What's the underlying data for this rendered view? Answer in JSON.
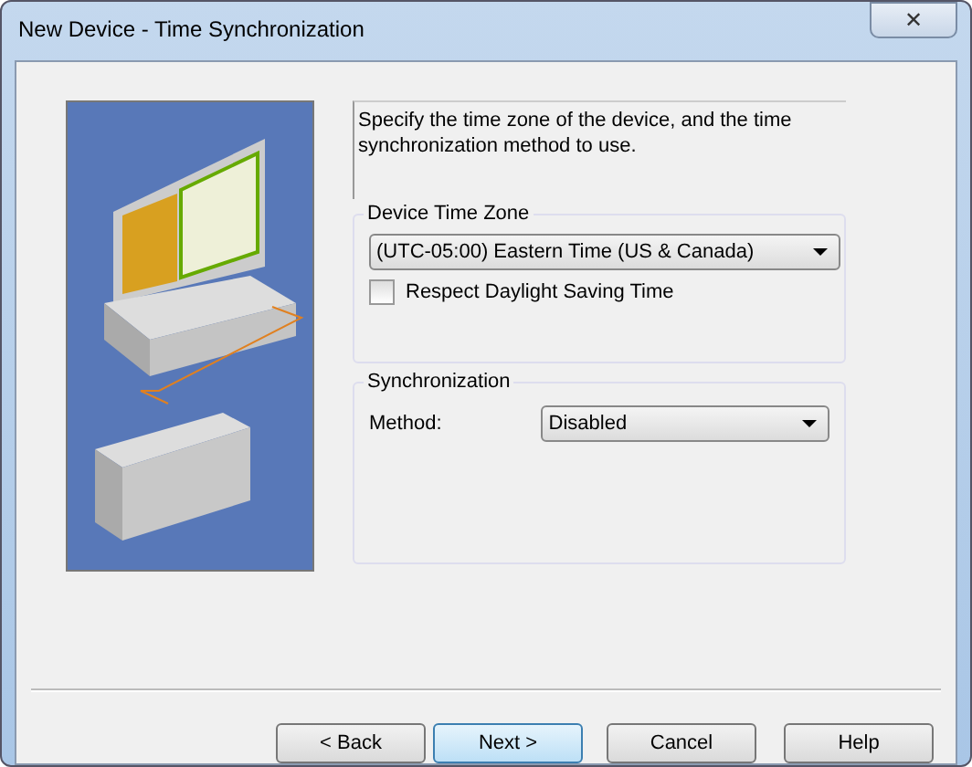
{
  "window": {
    "title": "New Device - Time Synchronization",
    "close": "✕"
  },
  "description": "Specify the time zone of the device, and the time synchronization method to use.",
  "time_zone_group": {
    "title": "Device Time Zone",
    "value": "(UTC-05:00) Eastern Time (US & Canada)",
    "dst": {
      "label": "Respect Daylight Saving Time",
      "checked": false
    }
  },
  "sync_group": {
    "title": "Synchronization",
    "method_label": "Method:",
    "method_value": "Disabled"
  },
  "buttons": [
    {
      "label": "< Back",
      "selected": false
    },
    {
      "label": "Next >",
      "selected": true
    },
    {
      "label": "Cancel",
      "selected": false
    },
    {
      "label": "Help",
      "selected": false
    }
  ]
}
